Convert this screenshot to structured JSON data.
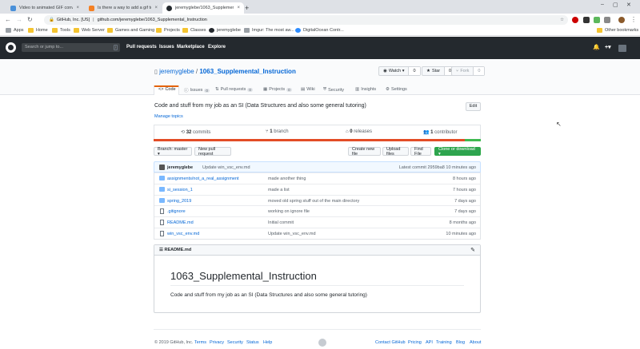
{
  "browser": {
    "tabs": [
      {
        "title": "Video to animated GIF converter",
        "active": false
      },
      {
        "title": "Is there a way to add a gif to a M",
        "active": false
      },
      {
        "title": "jeremyglebe/1063_Supplementa",
        "active": true
      }
    ],
    "new_tab": "+",
    "url_site": "GitHub, Inc. [US]",
    "url": "github.com/jeremyglebe/1063_Supplemental_Instruction",
    "bookmarks": [
      "Apps",
      "Home",
      "Tools",
      "Web Server",
      "Games and Gaming",
      "Projects",
      "Classes",
      "jeremyglebe",
      "Imgur: The most aw...",
      "DigitalOcean Contr..."
    ],
    "other_bookmarks": "Other bookmarks"
  },
  "gh": {
    "search_placeholder": "Search or jump to...",
    "search_key": "/",
    "nav": [
      "Pull requests",
      "Issues",
      "Marketplace",
      "Explore"
    ],
    "plus": "+▾"
  },
  "repo": {
    "owner": "jeremyglebe",
    "slash": " / ",
    "name": "1063_Supplemental_Instruction",
    "watch_label": "Watch ▾",
    "watch_count": "0",
    "star_label": "Star",
    "star_count": "0",
    "fork_label": "Fork",
    "fork_count": "0",
    "tabs": [
      {
        "label": "Code",
        "badge": ""
      },
      {
        "label": "Issues",
        "badge": "0"
      },
      {
        "label": "Pull requests",
        "badge": "0"
      },
      {
        "label": "Projects",
        "badge": "0"
      },
      {
        "label": "Wiki",
        "badge": ""
      },
      {
        "label": "Security",
        "badge": ""
      },
      {
        "label": "Insights",
        "badge": ""
      },
      {
        "label": "Settings",
        "badge": ""
      }
    ],
    "description": "Code and stuff from my job as an SI (Data Structures and also some general tutoring)",
    "edit_label": "Edit",
    "manage_topics": "Manage topics",
    "commits": "32",
    "commits_label": " commits",
    "branches": "1",
    "branches_label": " branch",
    "releases": "0",
    "releases_label": " releases",
    "contributors": "1",
    "contributors_label": " contributor",
    "lang_colors": [
      "#e34c26",
      "#3fb950"
    ],
    "branch_btn": "Branch: master ▾",
    "new_pr": "New pull request",
    "create_file": "Create new file",
    "upload_files": "Upload files",
    "find_file": "Find File",
    "clone": "Clone or download ▾",
    "latest_author": "jeremyglebe",
    "latest_msg": "Update win_vsc_env.md",
    "latest_commit": "Latest commit 2959ba8 10 minutes ago",
    "files": [
      {
        "name": "assignments/not_a_real_assignment",
        "type": "dir",
        "msg": "made another thing",
        "age": "8 hours ago"
      },
      {
        "name": "si_session_1",
        "type": "dir",
        "msg": "made a list",
        "age": "7 hours ago"
      },
      {
        "name": "spring_2019",
        "type": "dir",
        "msg": "moved old spring stuff out of the main directory",
        "age": "7 days ago"
      },
      {
        "name": ".gitignore",
        "type": "file",
        "msg": "working on ignore file",
        "age": "7 days ago"
      },
      {
        "name": "README.md",
        "type": "file",
        "msg": "Initial commit",
        "age": "8 months ago"
      },
      {
        "name": "win_vsc_env.md",
        "type": "file",
        "msg": "Update win_vsc_env.md",
        "age": "10 minutes ago"
      }
    ],
    "readme_label": "README.md",
    "readme_title": "1063_Supplemental_Instruction",
    "readme_body": "Code and stuff from my job as an SI (Data Structures and also some general tutoring)"
  },
  "footer": {
    "copyright": "© 2019 GitHub, Inc.",
    "left_links": [
      "Terms",
      "Privacy",
      "Security",
      "Status",
      "Help"
    ],
    "right_links": [
      "Contact GitHub",
      "Pricing",
      "API",
      "Training",
      "Blog",
      "About"
    ]
  }
}
